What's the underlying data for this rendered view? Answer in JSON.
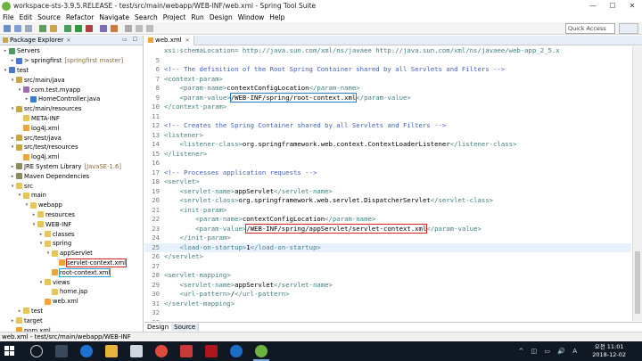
{
  "window": {
    "title": "workspace-sts-3.9.5.RELEASE - test/src/main/webapp/WEB-INF/web.xml - Spring Tool Suite",
    "controls": [
      "—",
      "☐",
      "✕"
    ]
  },
  "menu": [
    "File",
    "Edit",
    "Source",
    "Refactor",
    "Navigate",
    "Search",
    "Project",
    "Run",
    "Design",
    "Window",
    "Help"
  ],
  "toolbar": {
    "quick_access": "Quick Access"
  },
  "explorer": {
    "tab_label": "Package Explorer",
    "tree": [
      {
        "indent": 0,
        "twisty": ">",
        "icon": "srv",
        "label": "Servers",
        "note": ""
      },
      {
        "indent": 1,
        "twisty": ">",
        "icon": "proj",
        "label": "> springfirst",
        "note": "[springfirst master]"
      },
      {
        "indent": 0,
        "twisty": "v",
        "icon": "proj",
        "label": "test",
        "note": ""
      },
      {
        "indent": 1,
        "twisty": "v",
        "icon": "srcf",
        "label": "src/main/java",
        "note": ""
      },
      {
        "indent": 2,
        "twisty": "v",
        "icon": "pkg",
        "label": "com.test.myapp",
        "note": ""
      },
      {
        "indent": 3,
        "twisty": ">",
        "icon": "java",
        "label": "HomeController.java",
        "note": ""
      },
      {
        "indent": 1,
        "twisty": "v",
        "icon": "srcf",
        "label": "src/main/resources",
        "note": ""
      },
      {
        "indent": 2,
        "twisty": "",
        "icon": "fold",
        "label": "META-INF",
        "note": ""
      },
      {
        "indent": 2,
        "twisty": "",
        "icon": "xml",
        "label": "log4j.xml",
        "note": ""
      },
      {
        "indent": 1,
        "twisty": ">",
        "icon": "srcf",
        "label": "src/test/java",
        "note": ""
      },
      {
        "indent": 1,
        "twisty": "v",
        "icon": "srcf",
        "label": "src/test/resources",
        "note": ""
      },
      {
        "indent": 2,
        "twisty": "",
        "icon": "xml",
        "label": "log4j.xml",
        "note": ""
      },
      {
        "indent": 1,
        "twisty": ">",
        "icon": "lib",
        "label": "JRE System Library",
        "note": "[JavaSE-1.6]"
      },
      {
        "indent": 1,
        "twisty": ">",
        "icon": "lib",
        "label": "Maven Dependencies",
        "note": ""
      },
      {
        "indent": 1,
        "twisty": "v",
        "icon": "fold",
        "label": "src",
        "note": ""
      },
      {
        "indent": 2,
        "twisty": "v",
        "icon": "fold",
        "label": "main",
        "note": ""
      },
      {
        "indent": 3,
        "twisty": "v",
        "icon": "fold",
        "label": "webapp",
        "note": ""
      },
      {
        "indent": 4,
        "twisty": ">",
        "icon": "fold",
        "label": "resources",
        "note": ""
      },
      {
        "indent": 4,
        "twisty": "v",
        "icon": "fold",
        "label": "WEB-INF",
        "note": ""
      },
      {
        "indent": 5,
        "twisty": ">",
        "icon": "fold",
        "label": "classes",
        "note": ""
      },
      {
        "indent": 5,
        "twisty": "v",
        "icon": "fold",
        "label": "spring",
        "note": ""
      },
      {
        "indent": 6,
        "twisty": "v",
        "icon": "fold",
        "label": "appServlet",
        "note": ""
      },
      {
        "indent": 7,
        "twisty": "",
        "icon": "xml",
        "label": "servlet-context.xml",
        "note": "",
        "hl": "red"
      },
      {
        "indent": 6,
        "twisty": "",
        "icon": "xml",
        "label": "root-context.xml",
        "note": "",
        "hl": "blue"
      },
      {
        "indent": 5,
        "twisty": "v",
        "icon": "fold",
        "label": "views",
        "note": ""
      },
      {
        "indent": 6,
        "twisty": "",
        "icon": "fold",
        "label": "home.jsp",
        "note": ""
      },
      {
        "indent": 5,
        "twisty": "",
        "icon": "xml",
        "label": "web.xml",
        "note": ""
      },
      {
        "indent": 2,
        "twisty": ">",
        "icon": "fold",
        "label": "test",
        "note": ""
      },
      {
        "indent": 1,
        "twisty": ">",
        "icon": "fold",
        "label": "target",
        "note": ""
      },
      {
        "indent": 1,
        "twisty": "",
        "icon": "xml",
        "label": "pom.xml",
        "note": ""
      }
    ]
  },
  "editor": {
    "tab_label": "web.xml",
    "lines": [
      {
        "n": "",
        "segs": [
          {
            "c": "tg",
            "t": "xsi:schemaLocation= http://java.sun.com/xml/ns/javaee http://java.sun.com/xml/ns/javaee/web-app_2_5.x"
          }
        ]
      },
      {
        "n": "5",
        "segs": []
      },
      {
        "n": "6",
        "segs": [
          {
            "c": "cm",
            "t": "<!-- The definition of the Root Spring Container shared by all Servlets and Filters -->"
          }
        ]
      },
      {
        "n": "7",
        "segs": [
          {
            "c": "tg",
            "t": "<context-param>"
          }
        ]
      },
      {
        "n": "8",
        "segs": [
          {
            "c": "tg",
            "t": "    <param-name>"
          },
          {
            "c": "tx",
            "t": "contextConfigLocation"
          },
          {
            "c": "tg",
            "t": "</param-name>"
          }
        ]
      },
      {
        "n": "9",
        "segs": [
          {
            "c": "tg",
            "t": "    <param-value>"
          },
          {
            "c": "tx",
            "t": "/WEB-INF/spring/root-context.xml",
            "box": "blue"
          },
          {
            "c": "tg",
            "t": "</param-value>"
          }
        ]
      },
      {
        "n": "10",
        "segs": [
          {
            "c": "tg",
            "t": "</context-param>"
          }
        ]
      },
      {
        "n": "11",
        "segs": []
      },
      {
        "n": "12",
        "segs": [
          {
            "c": "cm",
            "t": "<!-- Creates the Spring Container shared by all Servlets and Filters -->"
          }
        ]
      },
      {
        "n": "13",
        "segs": [
          {
            "c": "tg",
            "t": "<listener>"
          }
        ]
      },
      {
        "n": "14",
        "segs": [
          {
            "c": "tg",
            "t": "    <listener-class>"
          },
          {
            "c": "tx",
            "t": "org.springframework.web.context.ContextLoaderListener"
          },
          {
            "c": "tg",
            "t": "</listener-class>"
          }
        ]
      },
      {
        "n": "15",
        "segs": [
          {
            "c": "tg",
            "t": "</listener>"
          }
        ]
      },
      {
        "n": "16",
        "segs": []
      },
      {
        "n": "17",
        "segs": [
          {
            "c": "cm",
            "t": "<!-- Processes application requests -->"
          }
        ]
      },
      {
        "n": "18",
        "segs": [
          {
            "c": "tg",
            "t": "<servlet>"
          }
        ]
      },
      {
        "n": "19",
        "segs": [
          {
            "c": "tg",
            "t": "    <servlet-name>"
          },
          {
            "c": "tx",
            "t": "appServlet"
          },
          {
            "c": "tg",
            "t": "</servlet-name>"
          }
        ]
      },
      {
        "n": "20",
        "segs": [
          {
            "c": "tg",
            "t": "    <servlet-class>"
          },
          {
            "c": "tx",
            "t": "org.springframework.web.servlet.DispatcherServlet"
          },
          {
            "c": "tg",
            "t": "</servlet-class>"
          }
        ]
      },
      {
        "n": "21",
        "segs": [
          {
            "c": "tg",
            "t": "    <init-param>"
          }
        ]
      },
      {
        "n": "22",
        "segs": [
          {
            "c": "tg",
            "t": "        <param-name>"
          },
          {
            "c": "tx",
            "t": "contextConfigLocation"
          },
          {
            "c": "tg",
            "t": "</param-name>"
          }
        ]
      },
      {
        "n": "23",
        "segs": [
          {
            "c": "tg",
            "t": "        <param-value>"
          },
          {
            "c": "tx",
            "t": "/WEB-INF/spring/appServlet/servlet-context.xml",
            "box": "red"
          },
          {
            "c": "tg",
            "t": "</param-value>"
          }
        ]
      },
      {
        "n": "24",
        "segs": [
          {
            "c": "tg",
            "t": "    </init-param>"
          }
        ]
      },
      {
        "n": "25",
        "segs": [
          {
            "c": "tg",
            "t": "    <load-on-startup>"
          },
          {
            "c": "tx",
            "t": "1"
          },
          {
            "c": "tg",
            "t": "</load-on-startup>"
          }
        ],
        "current": true
      },
      {
        "n": "26",
        "segs": [
          {
            "c": "tg",
            "t": "</servlet>"
          }
        ]
      },
      {
        "n": "27",
        "segs": []
      },
      {
        "n": "28",
        "segs": [
          {
            "c": "tg",
            "t": "<servlet-mapping>"
          }
        ]
      },
      {
        "n": "29",
        "segs": [
          {
            "c": "tg",
            "t": "    <servlet-name>"
          },
          {
            "c": "tx",
            "t": "appServlet"
          },
          {
            "c": "tg",
            "t": "</servlet-name>"
          }
        ]
      },
      {
        "n": "30",
        "segs": [
          {
            "c": "tg",
            "t": "    <url-pattern>"
          },
          {
            "c": "tx",
            "t": "/"
          },
          {
            "c": "tg",
            "t": "</url-pattern>"
          }
        ]
      },
      {
        "n": "31",
        "segs": [
          {
            "c": "tg",
            "t": "</servlet-mapping>"
          }
        ]
      },
      {
        "n": "32",
        "segs": []
      },
      {
        "n": "33",
        "segs": []
      }
    ],
    "bottom_tabs": [
      "Design",
      "Source"
    ]
  },
  "status": {
    "path": "web.xml - test/src/main/webapp/WEB-INF"
  },
  "taskbar": {
    "time": "오전 11:01",
    "date": "2018-12-02",
    "tray": "^ ◫ ▭ 🔊 A"
  },
  "colors": {
    "accent_blue": "#2c7fbf",
    "highlight_red": "#d22222",
    "taskbar": "#101824"
  }
}
